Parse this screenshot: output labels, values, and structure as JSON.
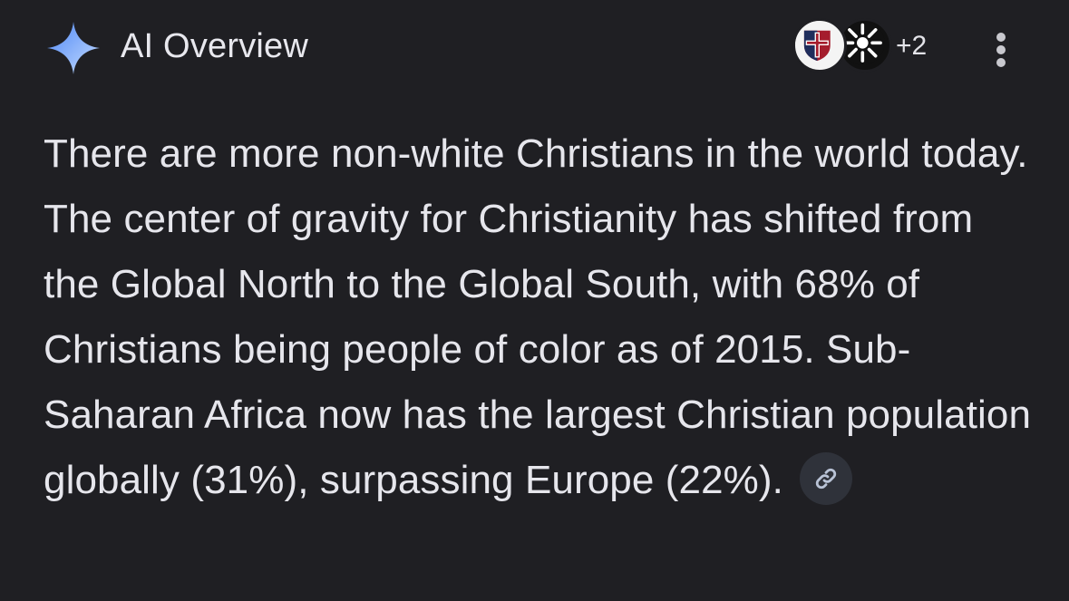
{
  "header": {
    "title": "AI Overview",
    "sparkle_icon": "sparkle-icon",
    "sources": {
      "avatars": [
        "shield-cross-logo",
        "black-white-sunburst-logo"
      ],
      "more_count": "+2"
    },
    "menu_icon": "more-vertical-icon"
  },
  "overview": {
    "text": "There are more non-white Christians in the world today. The center of gravity for Christianity has shifted from the Global North to the Global South, with 68% of Christians being people of color as of 2015. Sub-Saharan Africa now has the largest Christian population globally (31%), surpassing Europe (22%).",
    "link_icon": "link-icon"
  },
  "colors": {
    "background": "#1f1f23",
    "text": "#e6e6ec",
    "sparkle_gradient_start": "#3f78f0",
    "sparkle_gradient_end": "#bcd7ff",
    "chip_background": "#2f323a"
  }
}
